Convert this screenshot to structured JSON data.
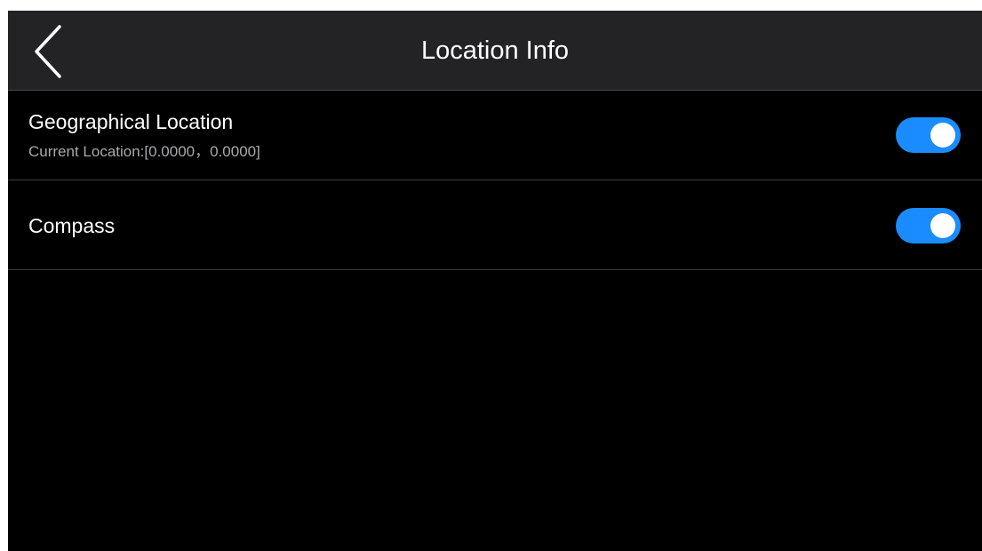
{
  "header": {
    "title": "Location Info",
    "back_icon": "chevron-left-icon"
  },
  "settings": [
    {
      "label": "Geographical Location",
      "sublabel": "Current Location:[0.0000，0.0000]",
      "enabled": true
    },
    {
      "label": "Compass",
      "enabled": true
    }
  ],
  "colors": {
    "background": "#000000",
    "header_bg": "#232325",
    "toggle_on": "#1a8cff",
    "subtext": "#a9a9ad"
  }
}
